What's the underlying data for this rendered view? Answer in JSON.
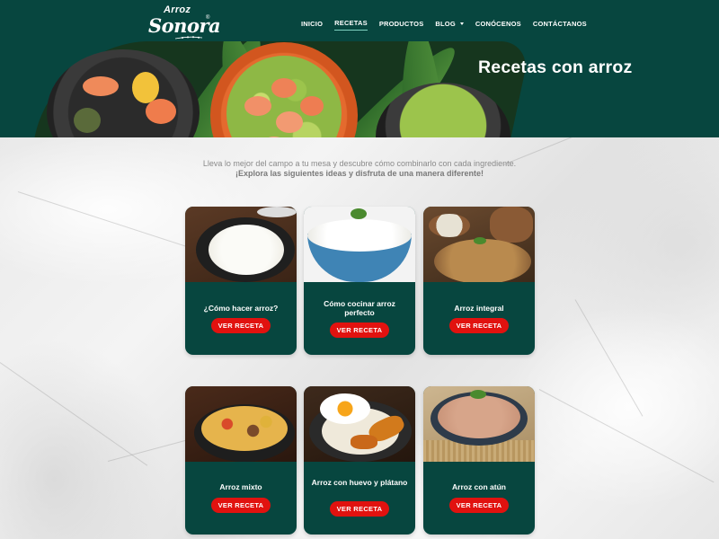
{
  "brand": {
    "logo_top": "Arroz",
    "logo_main": "Sonora",
    "logo_mark": "®"
  },
  "nav": {
    "items": [
      {
        "label": "INICIO"
      },
      {
        "label": "RECETAS"
      },
      {
        "label": "PRODUCTOS"
      },
      {
        "label": "BLOG"
      },
      {
        "label": "CONÓCENOS"
      },
      {
        "label": "CONTÁCTANOS"
      }
    ],
    "active": "RECETAS"
  },
  "hero": {
    "title": "Recetas con arroz"
  },
  "intro": {
    "line1": "Lleva lo mejor del campo a tu mesa y descubre cómo combinarlo con cada ingrediente.",
    "line2": "¡Explora las siguientes ideas y disfruta de una manera diferente!"
  },
  "cards": [
    {
      "title": "¿Cómo hacer arroz?",
      "button": "VER RECETA",
      "image": "pan-of-white-rice"
    },
    {
      "title": "Cómo cocinar arroz perfecto",
      "button": "VER RECETA",
      "image": "blue-bowl-white-rice"
    },
    {
      "title": "Arroz integral",
      "button": "VER RECETA",
      "image": "brown-rice-plate"
    },
    {
      "title": "Arroz mixto",
      "button": "VER RECETA",
      "image": "mixed-rice-skillet"
    },
    {
      "title": "Arroz con huevo y plátano",
      "button": "VER RECETA",
      "image": "rice-egg-plantain"
    },
    {
      "title": "Arroz con atún",
      "button": "VER RECETA",
      "image": "tuna-rice-bowl"
    }
  ],
  "colors": {
    "header_green": "#07463f",
    "button_red": "#e1120f",
    "nav_active_underline": "#7fd1c1"
  }
}
